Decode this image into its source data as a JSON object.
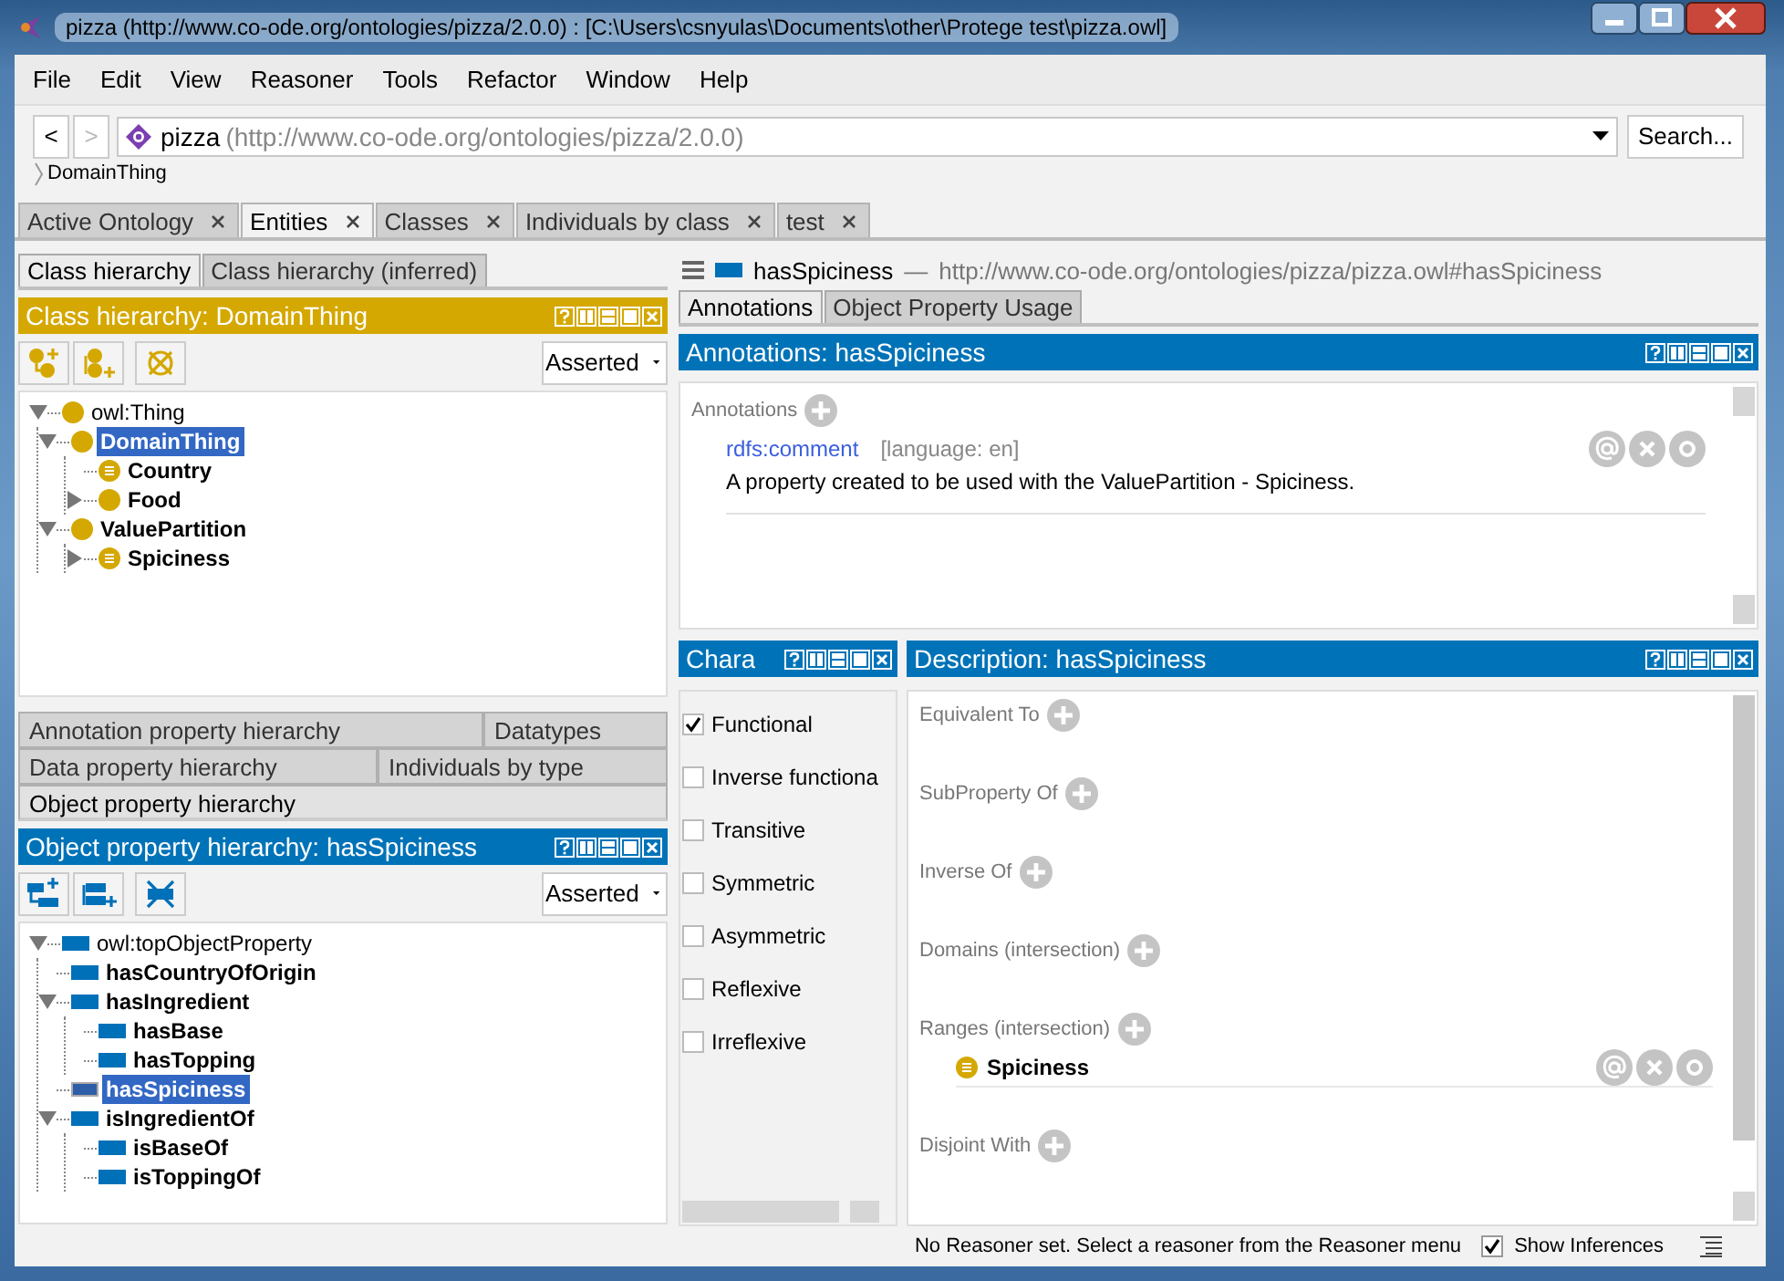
{
  "window": {
    "title": "pizza (http://www.co-ode.org/ontologies/pizza/2.0.0)  : [C:\\Users\\csnyulas\\Documents\\other\\Protege test\\pizza.owl]"
  },
  "menu": [
    "File",
    "Edit",
    "View",
    "Reasoner",
    "Tools",
    "Refactor",
    "Window",
    "Help"
  ],
  "nav": {
    "buttons": [
      {
        "label": "<",
        "disabled": false
      },
      {
        "label": ">",
        "disabled": true
      }
    ],
    "ontology_name": "pizza",
    "ontology_iri": "(http://www.co-ode.org/ontologies/pizza/2.0.0)",
    "search_button": "Search..."
  },
  "breadcrumb": "DomainThing",
  "tabs": [
    {
      "label": "Active Ontology",
      "selected": false
    },
    {
      "label": "Entities",
      "selected": true
    },
    {
      "label": "Classes",
      "selected": false
    },
    {
      "label": "Individuals by class",
      "selected": false
    },
    {
      "label": "test",
      "selected": false
    }
  ],
  "class_panel": {
    "tabs": [
      {
        "label": "Class hierarchy",
        "selected": true
      },
      {
        "label": "Class hierarchy (inferred)",
        "selected": false
      }
    ],
    "title": "Class hierarchy: DomainThing",
    "mode": "Asserted",
    "tree": [
      {
        "label": "owl:Thing",
        "kind": "class",
        "expanded": true,
        "selected": false,
        "children": [
          {
            "label": "DomainThing",
            "kind": "class",
            "expanded": true,
            "selected": true,
            "children": [
              {
                "label": "Country",
                "kind": "defined_class",
                "selected": false
              },
              {
                "label": "Food",
                "kind": "class",
                "expanded": false,
                "selected": false
              }
            ]
          },
          {
            "label": "ValuePartition",
            "kind": "class",
            "expanded": true,
            "selected": false,
            "children": [
              {
                "label": "Spiciness",
                "kind": "defined_class",
                "expanded": false,
                "selected": false
              }
            ]
          }
        ]
      }
    ]
  },
  "property_tab_rows": [
    [
      {
        "label": "Annotation property hierarchy",
        "selected": false
      },
      {
        "label": "Datatypes",
        "selected": false
      }
    ],
    [
      {
        "label": "Data property hierarchy",
        "selected": false
      },
      {
        "label": "Individuals by type",
        "selected": false
      }
    ],
    [
      {
        "label": "Object property hierarchy",
        "selected": true
      }
    ]
  ],
  "property_panel": {
    "title": "Object property hierarchy: hasSpiciness",
    "mode": "Asserted",
    "tree": [
      {
        "label": "owl:topObjectProperty",
        "kind": "property",
        "expanded": true,
        "selected": false,
        "children": [
          {
            "label": "hasCountryOfOrigin",
            "kind": "property",
            "selected": false
          },
          {
            "label": "hasIngredient",
            "kind": "property",
            "expanded": true,
            "selected": false,
            "children": [
              {
                "label": "hasBase",
                "kind": "property",
                "selected": false
              },
              {
                "label": "hasTopping",
                "kind": "property",
                "selected": false
              }
            ]
          },
          {
            "label": "hasSpiciness",
            "kind": "property",
            "selected": true
          },
          {
            "label": "isIngredientOf",
            "kind": "property",
            "expanded": true,
            "selected": false,
            "children": [
              {
                "label": "isBaseOf",
                "kind": "property",
                "selected": false
              },
              {
                "label": "isToppingOf",
                "kind": "property",
                "selected": false
              }
            ]
          }
        ]
      }
    ]
  },
  "entity": {
    "name": "hasSpiciness",
    "separator": "—",
    "iri": "http://www.co-ode.org/ontologies/pizza/pizza.owl#hasSpiciness"
  },
  "entity_tabs": [
    {
      "label": "Annotations",
      "selected": true
    },
    {
      "label": "Object Property Usage",
      "selected": false
    }
  ],
  "annotations_panel": {
    "title": "Annotations: hasSpiciness",
    "section_label": "Annotations",
    "items": [
      {
        "property": "rdfs:comment",
        "language": "[language: en]",
        "value": "A property created to be used with the ValuePartition - Spiciness."
      }
    ]
  },
  "characteristics_panel": {
    "title": "Chara",
    "items": [
      {
        "label": "Functional",
        "checked": true
      },
      {
        "label": "Inverse functiona",
        "checked": false
      },
      {
        "label": "Transitive",
        "checked": false
      },
      {
        "label": "Symmetric",
        "checked": false
      },
      {
        "label": "Asymmetric",
        "checked": false
      },
      {
        "label": "Reflexive",
        "checked": false
      },
      {
        "label": "Irreflexive",
        "checked": false
      }
    ]
  },
  "description_panel": {
    "title": "Description: hasSpiciness",
    "sections": [
      {
        "label": "Equivalent To"
      },
      {
        "label": "SubProperty Of"
      },
      {
        "label": "Inverse Of"
      },
      {
        "label": "Domains (intersection)"
      },
      {
        "label": "Ranges (intersection)",
        "items": [
          {
            "label": "Spiciness",
            "kind": "defined_class"
          }
        ]
      },
      {
        "label": "Disjoint With"
      }
    ]
  },
  "status": {
    "message": "No Reasoner set. Select a reasoner from the Reasoner menu",
    "show_inferences": {
      "label": "Show Inferences",
      "checked": true
    }
  }
}
